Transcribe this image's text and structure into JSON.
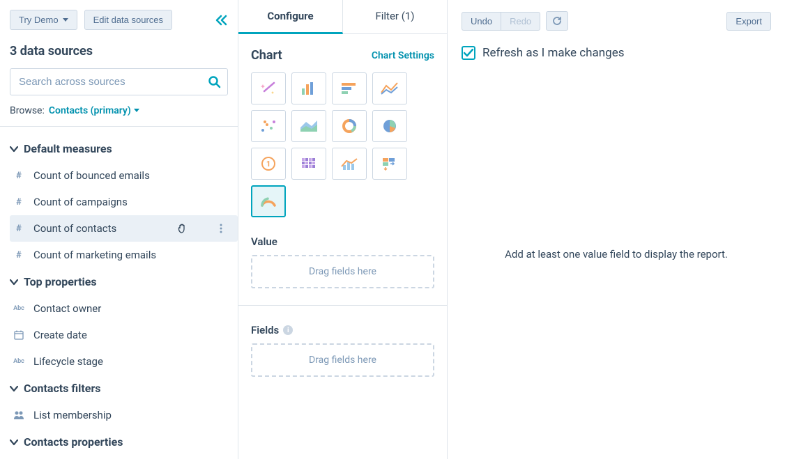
{
  "sidebar": {
    "try_demo": "Try Demo",
    "edit_sources": "Edit data sources",
    "source_count": "3 data sources",
    "search_placeholder": "Search across sources",
    "browse_label": "Browse:",
    "browse_value": "Contacts (primary)",
    "groups": [
      {
        "title": "Default measures",
        "items": [
          {
            "icon": "hash",
            "label": "Count of bounced emails"
          },
          {
            "icon": "hash",
            "label": "Count of campaigns"
          },
          {
            "icon": "hash",
            "label": "Count of contacts",
            "hover": true
          },
          {
            "icon": "hash",
            "label": "Count of marketing emails"
          }
        ]
      },
      {
        "title": "Top properties",
        "items": [
          {
            "icon": "abc",
            "label": "Contact owner"
          },
          {
            "icon": "date",
            "label": "Create date"
          },
          {
            "icon": "abc",
            "label": "Lifecycle stage"
          }
        ]
      },
      {
        "title": "Contacts filters",
        "items": [
          {
            "icon": "people",
            "label": "List membership"
          }
        ]
      },
      {
        "title": "Contacts properties",
        "items": []
      }
    ]
  },
  "mid": {
    "tabs": [
      {
        "label": "Configure",
        "active": true
      },
      {
        "label": "Filter (1)",
        "active": false
      }
    ],
    "chart_label": "Chart",
    "chart_settings": "Chart Settings",
    "chart_types": [
      {
        "name": "magic-wand"
      },
      {
        "name": "bar-vertical"
      },
      {
        "name": "bar-horizontal"
      },
      {
        "name": "line"
      },
      {
        "name": "scatter"
      },
      {
        "name": "area"
      },
      {
        "name": "donut"
      },
      {
        "name": "pie"
      },
      {
        "name": "kpi"
      },
      {
        "name": "heatmap"
      },
      {
        "name": "combo"
      },
      {
        "name": "pivot"
      },
      {
        "name": "gauge",
        "selected": true
      }
    ],
    "value_label": "Value",
    "fields_label": "Fields",
    "dropzone_text": "Drag fields here"
  },
  "right": {
    "undo": "Undo",
    "redo": "Redo",
    "export": "Export",
    "refresh_label": "Refresh as I make changes",
    "placeholder": "Add at least one value field to display the report."
  }
}
